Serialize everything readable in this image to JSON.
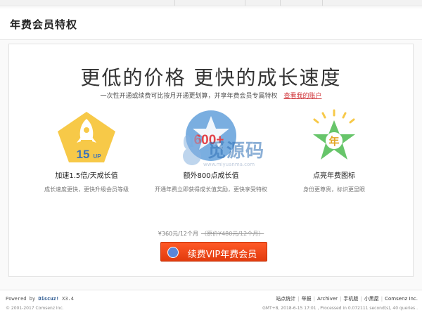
{
  "header": {
    "title": "年费会员特权"
  },
  "headline": "更低的价格 更快的成长速度",
  "subline": {
    "text": "一次性开通或续费可比按月开通更划算，并享年费会员专属特权",
    "link": "查看我的账户"
  },
  "features": [
    {
      "badge": "15",
      "badge_sub": "UP",
      "title": "加速1.5倍/天成长值",
      "desc": "成长速度更快，更快升级会员等级"
    },
    {
      "badge": "600+",
      "title": "额外800点成长值",
      "desc": "开通年费立即获得成长值奖励，更快享受特权"
    },
    {
      "badge": "年",
      "title": "点亮年费图标",
      "desc": "身份更尊贵，标识更显眼"
    }
  ],
  "price": {
    "text": "¥360元/12个月",
    "old": "（原价¥480元/12个月）"
  },
  "cta": {
    "label": "续费VIP年费会员"
  },
  "watermark": {
    "site": "觅源码",
    "sub": "www.miyuanma.com"
  },
  "footer": {
    "powered_prefix": "Powered by",
    "powered_name": "Discuz!",
    "powered_ver": "X3.4",
    "copyright": "© 2001-2017 Comsenz Inc.",
    "links": [
      "站点统计",
      "举报",
      "Archiver",
      "手机版",
      "小黑屋",
      "Comsenz Inc."
    ],
    "right2": "GMT+8, 2018-6-15 17:01 , Processed in 0.072111 second(s), 40 queries ."
  },
  "colors": {
    "accent": "#e23b0d",
    "link": "#d0353a",
    "badge_yellow": "#f7c948",
    "badge_blue": "#7aaee0",
    "badge_green": "#67c56a"
  }
}
